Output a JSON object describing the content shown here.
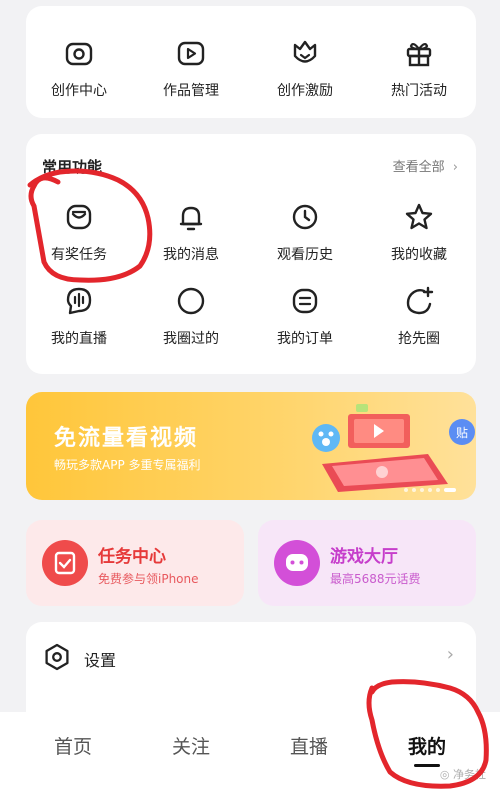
{
  "creator_tools": [
    {
      "icon": "camera-icon",
      "label": "创作中心"
    },
    {
      "icon": "video-play-icon",
      "label": "作品管理"
    },
    {
      "icon": "crown-shield-icon",
      "label": "创作激励"
    },
    {
      "icon": "gift-icon",
      "label": "热门活动"
    }
  ],
  "common": {
    "title": "常用功能",
    "view_all": "查看全部",
    "items": [
      {
        "icon": "reward-task-icon",
        "label": "有奖任务"
      },
      {
        "icon": "bell-icon",
        "label": "我的消息"
      },
      {
        "icon": "clock-icon",
        "label": "观看历史"
      },
      {
        "icon": "star-icon",
        "label": "我的收藏"
      },
      {
        "icon": "live-audio-icon",
        "label": "我的直播"
      },
      {
        "icon": "circle-icon",
        "label": "我圈过的"
      },
      {
        "icon": "order-icon",
        "label": "我的订单"
      },
      {
        "icon": "refresh-plus-icon",
        "label": "抢先圈"
      }
    ]
  },
  "banner": {
    "title": "免流量看视频",
    "subtitle": "畅玩多款APP 多重专属福利",
    "badge": "贴"
  },
  "task_center": {
    "title": "任务中心",
    "subtitle": "免费参与领iPhone",
    "color": "#ef4b4b"
  },
  "game_hall": {
    "title": "游戏大厅",
    "subtitle": "最高5688元话费",
    "color": "#d34fd8"
  },
  "settings": {
    "label": "设置"
  },
  "tabs": [
    {
      "label": "首页"
    },
    {
      "label": "关注"
    },
    {
      "label": "直播"
    },
    {
      "label": "我的",
      "active": true
    }
  ],
  "watermark": "净务社"
}
